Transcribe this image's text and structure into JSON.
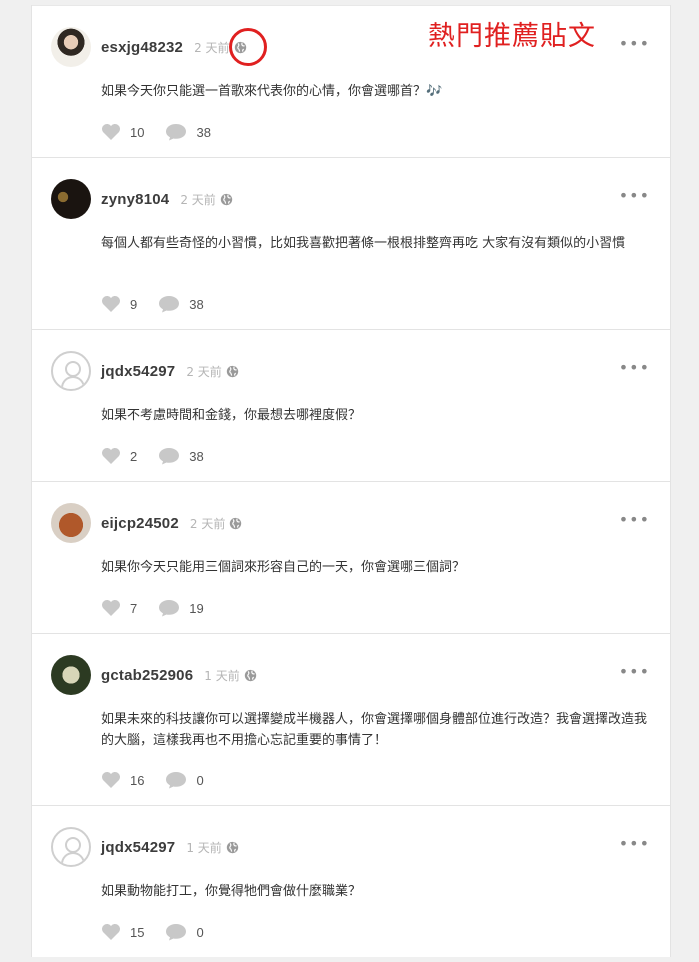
{
  "header": {
    "hot_title": "熱門推薦貼文"
  },
  "icons": {
    "like": "heart-icon",
    "comment": "comment-icon",
    "visibility": "globe-icon",
    "menu": "more-icon"
  },
  "colors": {
    "accent": "#e02020",
    "icon_gray": "#c8c8c8"
  },
  "posts": [
    {
      "username": "esxjg48232",
      "time": "2 天前",
      "content": "如果今天你只能選一首歌來代表你的心情，你會選哪首？🎶",
      "likes": "10",
      "comments": "38",
      "avatar": "photo"
    },
    {
      "username": "zyny8104",
      "time": "2 天前",
      "content": "每個人都有些奇怪的小習慣，比如我喜歡把著條一根根排整齊再吃 大家有沒有類似的小習慣",
      "likes": "9",
      "comments": "38",
      "avatar": "photo"
    },
    {
      "username": "jqdx54297",
      "time": "2 天前",
      "content": "如果不考慮時間和金錢，你最想去哪裡度假？",
      "likes": "2",
      "comments": "38",
      "avatar": "default"
    },
    {
      "username": "eijcp24502",
      "time": "2 天前",
      "content": "如果你今天只能用三個詞來形容自己的一天，你會選哪三個詞？",
      "likes": "7",
      "comments": "19",
      "avatar": "photo"
    },
    {
      "username": "gctab252906",
      "time": "1 天前",
      "content": "如果未來的科技讓你可以選擇變成半機器人，你會選擇哪個身體部位進行改造？我會選擇改造我的大腦，這樣我再也不用擔心忘記重要的事情了！",
      "likes": "16",
      "comments": "0",
      "avatar": "photo"
    },
    {
      "username": "jqdx54297",
      "time": "1 天前",
      "content": "如果動物能打工，你覺得牠們會做什麼職業？",
      "likes": "15",
      "comments": "0",
      "avatar": "default"
    }
  ]
}
